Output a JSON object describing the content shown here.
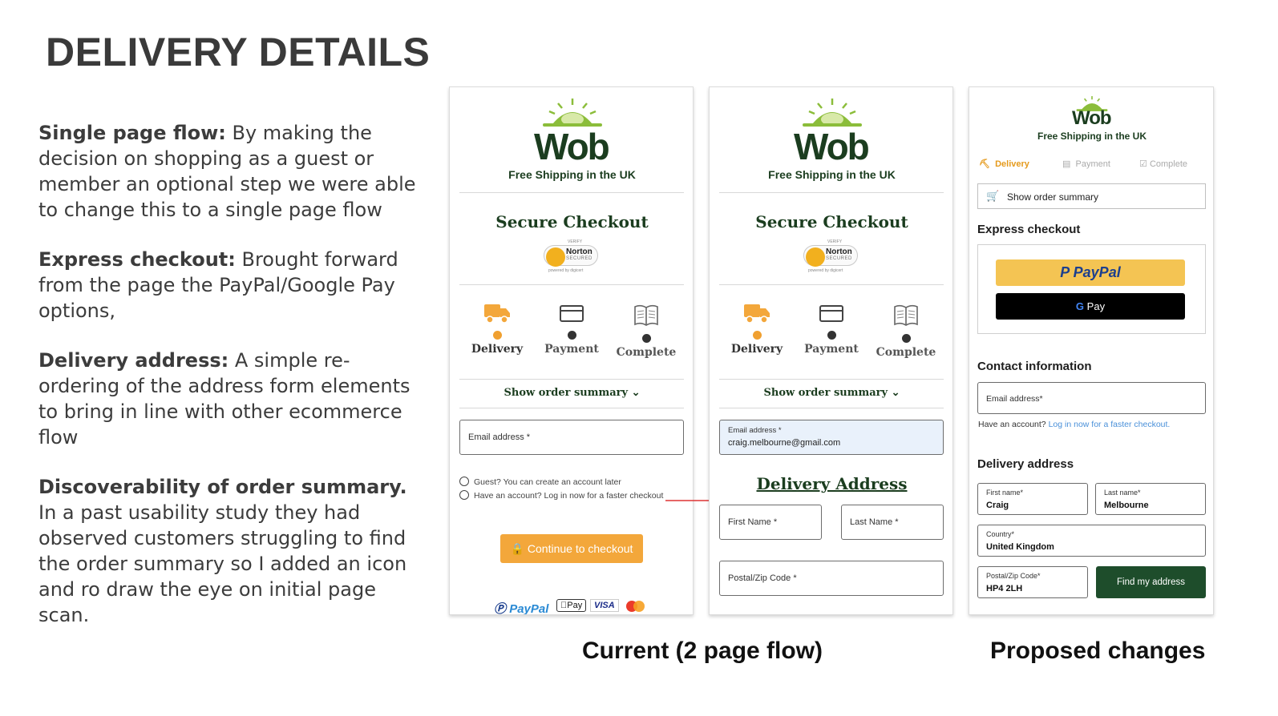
{
  "slide": {
    "title": "DELIVERY DETAILS",
    "caption_current": "Current (2 page flow)",
    "caption_proposed": "Proposed changes"
  },
  "notes": [
    {
      "heading": "Single page flow:",
      "body": " By making the decision on shopping as a guest or member an optional step we were able to change this to a single page flow"
    },
    {
      "heading": "Express checkout:",
      "body": "  Brought forward from the page the PayPal/Google Pay options,"
    },
    {
      "heading": "Delivery address:",
      "body": " A simple re-ordering of  the address form elements to bring in line with other ecommerce flow"
    },
    {
      "heading": "Discoverability of order summary.",
      "body": " In a past usability study they had observed customers struggling to find the order summary so I added an icon and ro draw the eye on initial page scan."
    }
  ],
  "brand": {
    "logo_text": "Wob",
    "tagline": "Free Shipping in the UK",
    "accent": "#f3a73b",
    "dark_green": "#1b3d1f"
  },
  "current_1": {
    "heading": "Secure Checkout",
    "norton": {
      "top": "VERIFY",
      "name": "Norton",
      "sub": "SECURED",
      "powered": "powered by digicert"
    },
    "steps": [
      {
        "label": "Delivery",
        "icon": "truck-icon",
        "active": true
      },
      {
        "label": "Payment",
        "icon": "card-icon",
        "active": false
      },
      {
        "label": "Complete",
        "icon": "book-icon",
        "active": false
      }
    ],
    "summary_label": "Show order summary",
    "email_label": "Email address *",
    "radio_guest": "Guest? You can create an account later",
    "radio_account": "Have an account? Log in now for a faster checkout",
    "cta": "Continue to checkout",
    "pay_logos": {
      "paypal": "PayPal",
      "apple": "Pay",
      "visa": "VISA"
    }
  },
  "current_2": {
    "heading": "Secure Checkout",
    "norton": {
      "top": "VERIFY",
      "name": "Norton",
      "sub": "SECURED",
      "powered": "powered by digicert"
    },
    "steps": [
      {
        "label": "Delivery",
        "icon": "truck-icon",
        "active": true
      },
      {
        "label": "Payment",
        "icon": "card-icon",
        "active": false
      },
      {
        "label": "Complete",
        "icon": "book-icon",
        "active": false
      }
    ],
    "summary_label": "Show order summary",
    "email_label": "Email address *",
    "email_value": "craig.melbourne@gmail.com",
    "delivery_heading": "Delivery Address",
    "first_name": "First Name *",
    "last_name": "Last Name *",
    "postal": "Postal/Zip Code *"
  },
  "proposed": {
    "tagline": "Free Shipping in the UK",
    "tabs": [
      {
        "label": "Delivery",
        "active": true
      },
      {
        "label": "Payment",
        "active": false
      },
      {
        "label": "Complete",
        "active": false
      }
    ],
    "summary_label": "Show order summary",
    "express_heading": "Express checkout",
    "paypal_label": "PayPal",
    "gpay_label": "Pay",
    "contact_heading": "Contact information",
    "email_label": "Email address*",
    "account_prompt": "Have an account?",
    "account_link": "Log in now for a faster checkout.",
    "delivery_heading": "Delivery address",
    "first_name_label": "First name*",
    "first_name_value": "Craig",
    "last_name_label": "Last name*",
    "last_name_value": "Melbourne",
    "country_label": "Country*",
    "country_value": "United Kingdom",
    "postal_label": "Postal/Zip Code*",
    "postal_value": "HP4 2LH",
    "find_button": "Find my address"
  }
}
